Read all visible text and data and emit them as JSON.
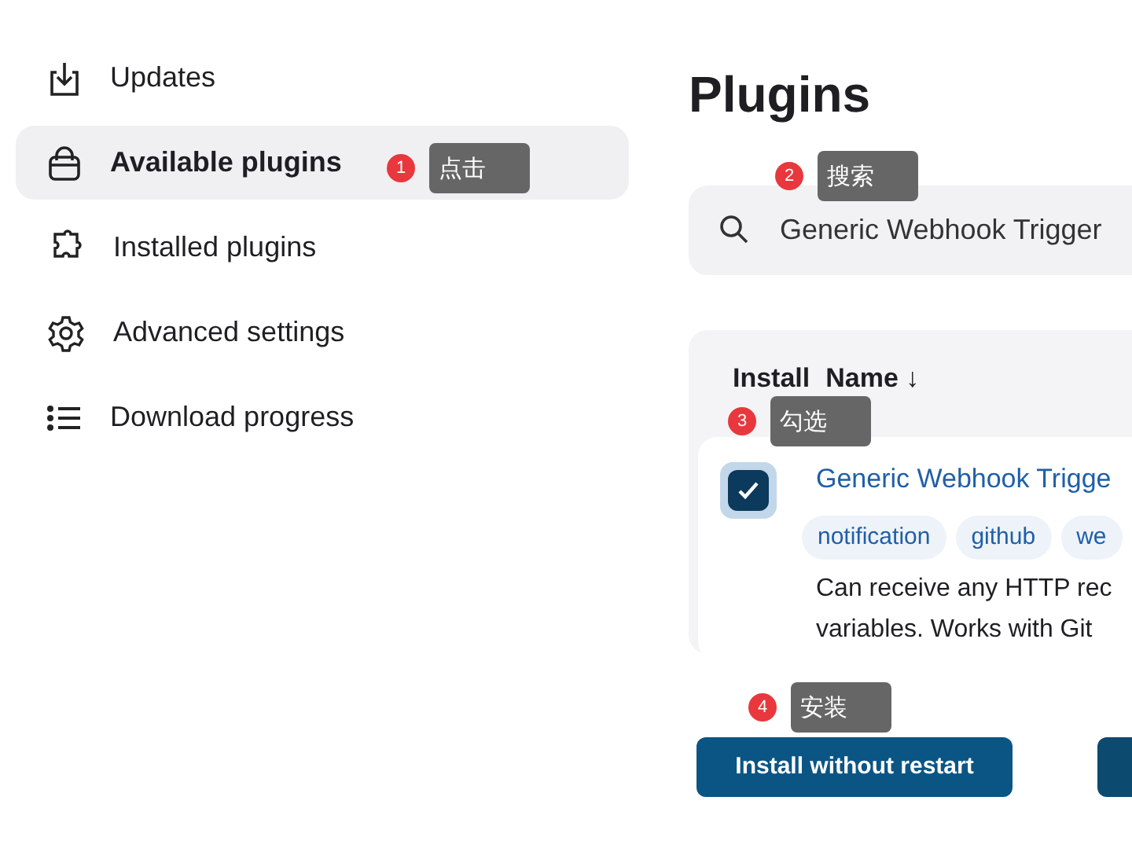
{
  "sidebar": {
    "items": [
      {
        "label": "Updates",
        "selected": false
      },
      {
        "label": "Available plugins",
        "selected": true
      },
      {
        "label": "Installed plugins",
        "selected": false
      },
      {
        "label": "Advanced settings",
        "selected": false
      },
      {
        "label": "Download progress",
        "selected": false
      }
    ]
  },
  "title": "Plugins",
  "search": {
    "value": "Generic Webhook Trigger"
  },
  "table": {
    "columns": [
      "Install",
      "Name ↓"
    ],
    "rows": [
      {
        "checked": true,
        "name": "Generic Webhook Trigge",
        "tags": [
          "notification",
          "github",
          "we"
        ],
        "description": [
          "Can receive any HTTP rec",
          "variables. Works with Git"
        ]
      }
    ]
  },
  "buttons": [
    "Install without restart"
  ],
  "annotations": [
    {
      "number": "1",
      "label": "点击"
    },
    {
      "number": "2",
      "label": "搜索"
    },
    {
      "number": "3",
      "label": "勾选"
    },
    {
      "number": "4",
      "label": "安装"
    }
  ]
}
